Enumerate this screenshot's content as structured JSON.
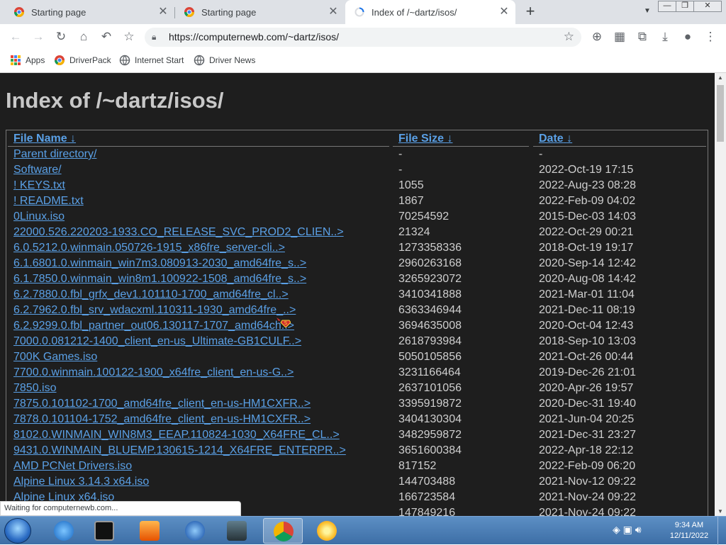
{
  "browser": {
    "tabs": [
      {
        "label": "Starting page",
        "active": false
      },
      {
        "label": "Starting page",
        "active": false
      },
      {
        "label": "Index of /~dartz/isos/",
        "active": true
      }
    ],
    "new_tab": "+",
    "close_glyph": "✕",
    "url": "https://computernewb.com/~dartz/isos/",
    "bookmarks": [
      "Apps",
      "DriverPack",
      "Internet Start",
      "Driver News"
    ],
    "status_text": "Waiting for computernewb.com..."
  },
  "page": {
    "title": "Index of /~dartz/isos/",
    "headers": {
      "name": "File Name",
      "size": "File Size",
      "date": "Date",
      "sort_arrow": "↓"
    },
    "rows": [
      {
        "name": "Parent directory/",
        "size": "-",
        "date": "-"
      },
      {
        "name": "Software/",
        "size": "-",
        "date": "2022-Oct-19 17:15"
      },
      {
        "name": "! KEYS.txt",
        "size": "1055",
        "date": "2022-Aug-23 08:28"
      },
      {
        "name": "! README.txt",
        "size": "1867",
        "date": "2022-Feb-09 04:02"
      },
      {
        "name": "0Linux.iso",
        "size": "70254592",
        "date": "2015-Dec-03 14:03"
      },
      {
        "name": "22000.526.220203-1933.CO_RELEASE_SVC_PROD2_CLIEN..>",
        "size": "21324",
        "date": "2022-Oct-29 00:21"
      },
      {
        "name": "6.0.5212.0.winmain.050726-1915_x86fre_server-cli..>",
        "size": "1273358336",
        "date": "2018-Oct-19 19:17"
      },
      {
        "name": "6.1.6801.0.winmain_win7m3.080913-2030_amd64fre_s..>",
        "size": "2960263168",
        "date": "2020-Sep-14 12:42"
      },
      {
        "name": "6.1.7850.0.winmain_win8m1.100922-1508_amd64fre_s..>",
        "size": "3265923072",
        "date": "2020-Aug-08 14:42"
      },
      {
        "name": "6.2.7880.0.fbl_grfx_dev1.101110-1700_amd64fre_cl..>",
        "size": "3410341888",
        "date": "2021-Mar-01 11:04"
      },
      {
        "name": "6.2.7962.0.fbl_srv_wdacxml.110311-1930_amd64fre_..>",
        "size": "6363346944",
        "date": "2021-Dec-11 08:19"
      },
      {
        "name": "6.2.9299.0.fbl_partner_out06.130117-1707_amd64ch..>",
        "size": "3694635008",
        "date": "2020-Oct-04 12:43"
      },
      {
        "name": "7000.0.081212-1400_client_en-us_Ultimate-GB1CULF..>",
        "size": "2618793984",
        "date": "2018-Sep-10 13:03"
      },
      {
        "name": "700K Games.iso",
        "size": "5050105856",
        "date": "2021-Oct-26 00:44"
      },
      {
        "name": "7700.0.winmain.100122-1900_x64fre_client_en-us-G..>",
        "size": "3231166464",
        "date": "2019-Dec-26 21:01"
      },
      {
        "name": "7850.iso",
        "size": "2637101056",
        "date": "2020-Apr-26 19:57"
      },
      {
        "name": "7875.0.101102-1700_amd64fre_client_en-us-HM1CXFR..>",
        "size": "3395919872",
        "date": "2020-Dec-31 19:40"
      },
      {
        "name": "7878.0.101104-1752_amd64fre_client_en-us-HM1CXFR..>",
        "size": "3404130304",
        "date": "2021-Jun-04 20:25"
      },
      {
        "name": "8102.0.WINMAIN_WIN8M3_EEAP.110824-1030_X64FRE_CL..>",
        "size": "3482959872",
        "date": "2021-Dec-31 23:27"
      },
      {
        "name": "9431.0.WINMAIN_BLUEMP.130615-1214_X64FRE_ENTERPR..>",
        "size": "3651600384",
        "date": "2022-Apr-18 22:12"
      },
      {
        "name": "AMD PCNet Drivers.iso",
        "size": "817152",
        "date": "2022-Feb-09 06:20"
      },
      {
        "name": "Alpine Linux 3.14.3 x64.iso",
        "size": "144703488",
        "date": "2021-Nov-12 09:22"
      },
      {
        "name": "Alpine Linux x64.iso",
        "size": "166723584",
        "date": "2021-Nov-24 09:22"
      },
      {
        "name": "",
        "size": "147849216",
        "date": "2021-Nov-24 09:22"
      }
    ]
  },
  "taskbar": {
    "time": "9:34 AM",
    "date": "12/11/2022"
  },
  "colors": {
    "page_bg": "#1e1e1e",
    "link": "#5aa0e6",
    "text": "#cfcfcf",
    "taskbar": "#3d6ea6"
  }
}
